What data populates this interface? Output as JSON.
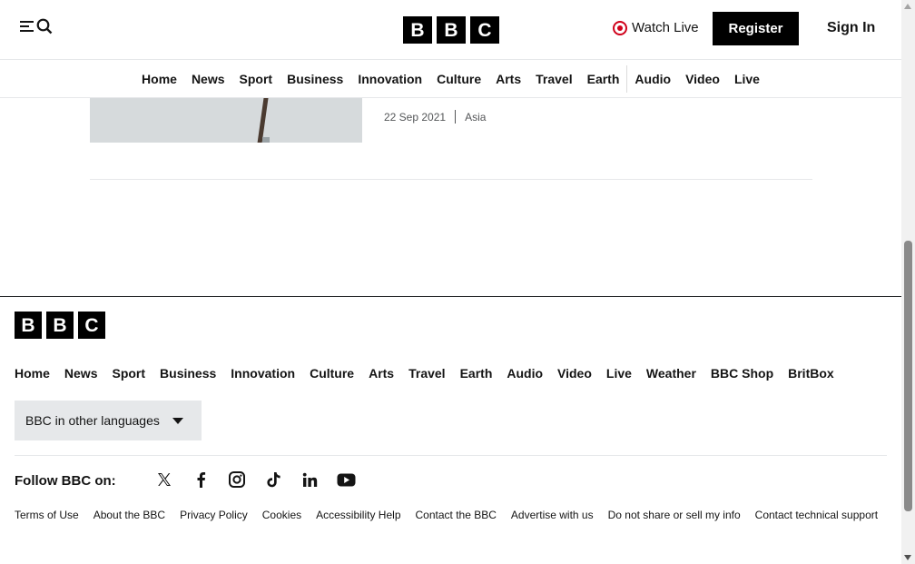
{
  "header": {
    "logo_letters": [
      "B",
      "B",
      "C"
    ],
    "watch_live_label": "Watch Live",
    "register_label": "Register",
    "signin_label": "Sign In"
  },
  "top_nav": [
    "Home",
    "News",
    "Sport",
    "Business",
    "Innovation",
    "Culture",
    "Arts",
    "Travel",
    "Earth",
    "Audio",
    "Video",
    "Live"
  ],
  "article": {
    "date": "22 Sep 2021",
    "region": "Asia"
  },
  "footer": {
    "logo_letters": [
      "B",
      "B",
      "C"
    ],
    "nav": [
      "Home",
      "News",
      "Sport",
      "Business",
      "Innovation",
      "Culture",
      "Arts",
      "Travel",
      "Earth",
      "Audio",
      "Video",
      "Live",
      "Weather",
      "BBC Shop",
      "BritBox"
    ],
    "languages_label": "BBC in other languages",
    "follow_label": "Follow BBC on:",
    "social_icons": [
      "x-icon",
      "facebook-icon",
      "instagram-icon",
      "tiktok-icon",
      "linkedin-icon",
      "youtube-icon"
    ],
    "legal_links": [
      "Terms of Use",
      "About the BBC",
      "Privacy Policy",
      "Cookies",
      "Accessibility Help",
      "Contact the BBC",
      "Advertise with us",
      "Do not share or sell my info",
      "Contact technical support"
    ]
  },
  "colors": {
    "live_red": "#d0021b",
    "text": "#141414",
    "muted": "#545658",
    "panel": "#e6e8ea"
  }
}
